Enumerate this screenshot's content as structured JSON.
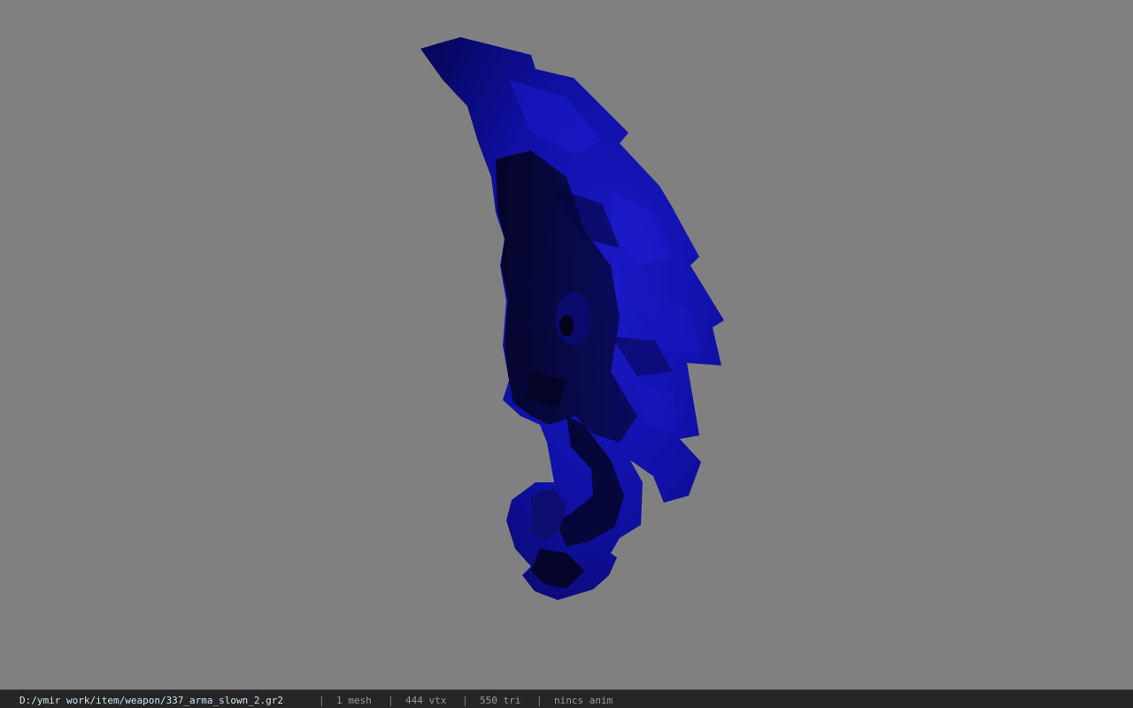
{
  "viewport": {
    "background_color": "#808080",
    "model": {
      "subject": "blue-claw-blade-weapon",
      "primary_color": "#1010a8",
      "shadow_color": "#05052a"
    }
  },
  "statusbar": {
    "file_path": "D:/ymir work/item/weapon/337_arma_slown_2.gr2",
    "separator": "|",
    "mesh_count": "1 mesh",
    "vertex_count": "444 vtx",
    "triangle_count": "550 tri",
    "animation_status": "nincs anim"
  }
}
